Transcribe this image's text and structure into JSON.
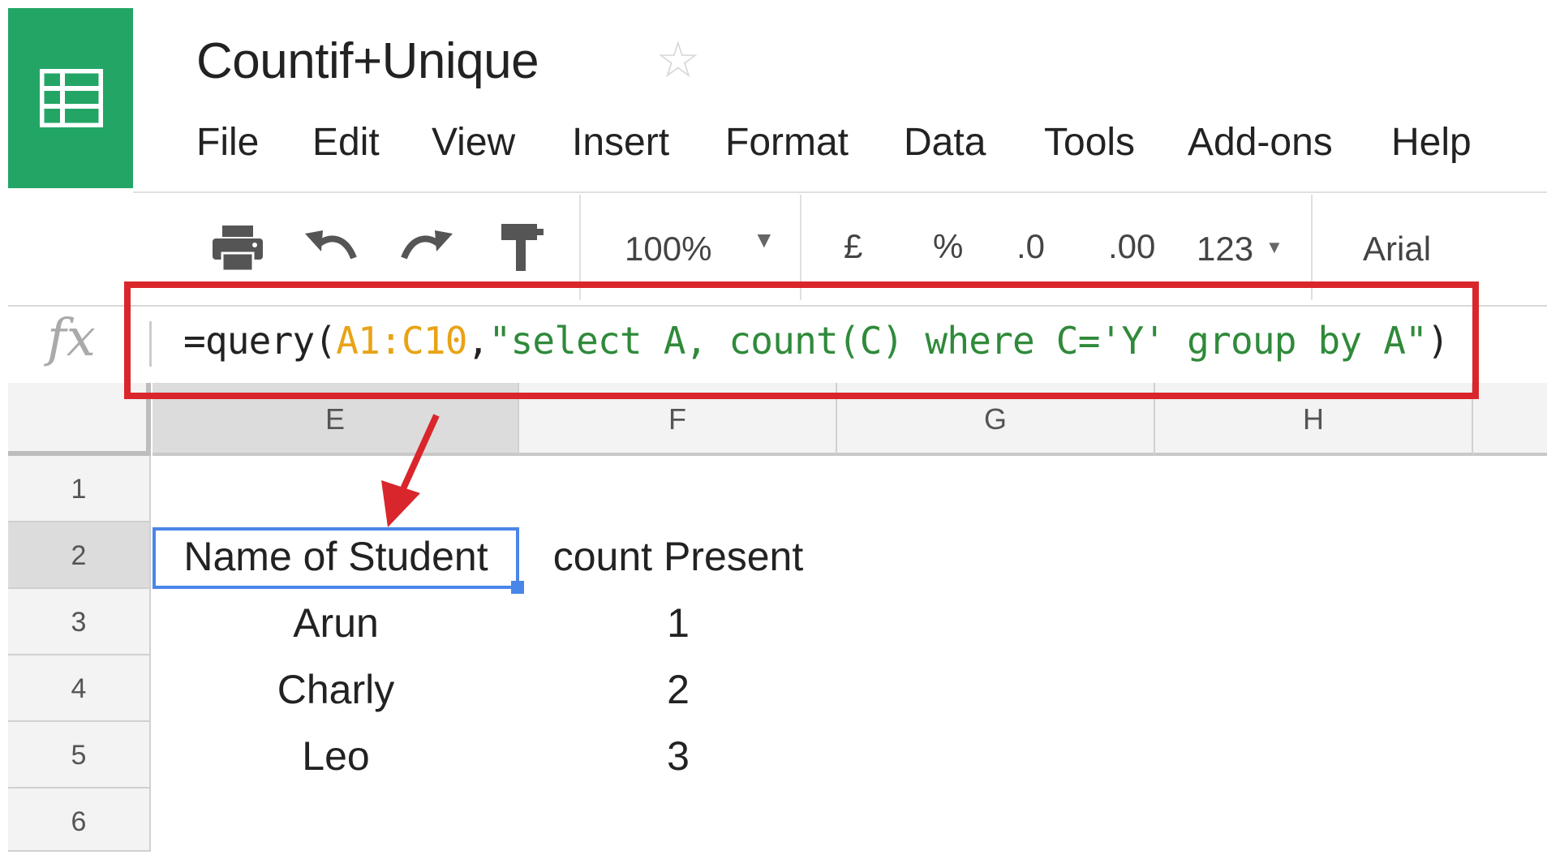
{
  "app": {
    "title": "Countif+Unique",
    "logo_icon": "sheets-logo-icon",
    "star_icon": "star-icon",
    "brand_color": "#23a566"
  },
  "menu": [
    "File",
    "Edit",
    "View",
    "Insert",
    "Format",
    "Data",
    "Tools",
    "Add-ons",
    "Help"
  ],
  "toolbar": {
    "zoom": "100%",
    "currency": "£",
    "percent": "%",
    "decrease_decimal": ".0",
    "increase_decimal": ".00",
    "number_format": "123",
    "font": "Arial"
  },
  "formula_bar": {
    "fx_label": "fx",
    "prefix": "=query(",
    "range": "A1:C10",
    "separator": ",",
    "query_string": "\"select A, count(C) where C='Y' group by A\"",
    "suffix": ")",
    "highlight_color": "#d9262c"
  },
  "columns": [
    "E",
    "F",
    "G",
    "H"
  ],
  "rows": [
    "1",
    "2",
    "3",
    "4",
    "5",
    "6"
  ],
  "cells": {
    "E2": "Name of Student",
    "F2": "count Present",
    "E3": "Arun",
    "F3": "1",
    "E4": "Charly",
    "F4": "2",
    "E5": "Leo",
    "F5": "3"
  },
  "selected_cell": "E2"
}
